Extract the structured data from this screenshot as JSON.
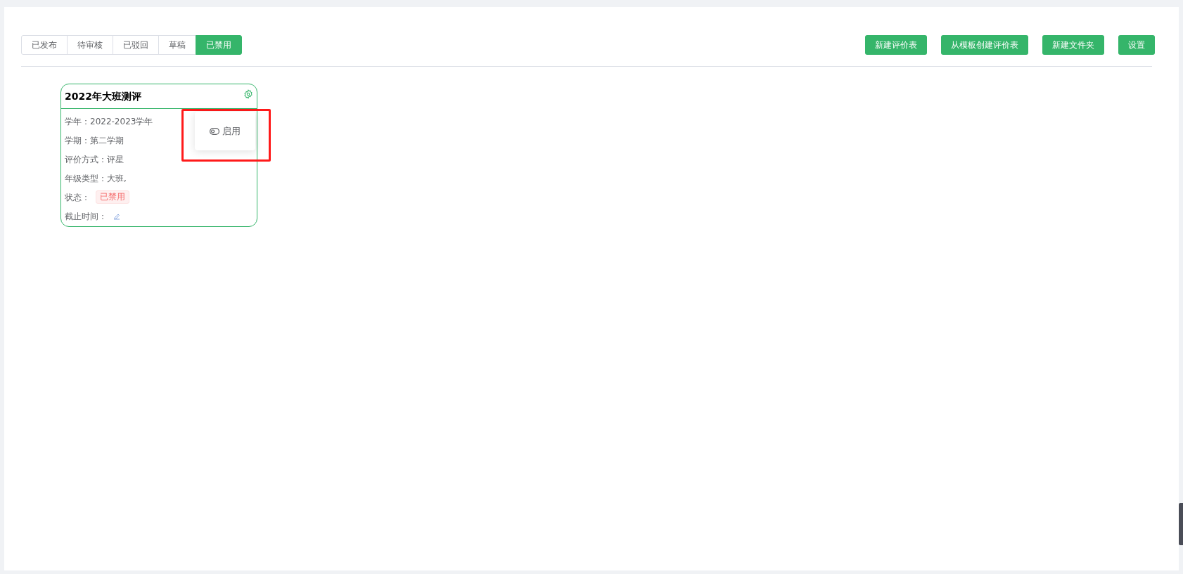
{
  "tabs": [
    {
      "label": "已发布",
      "selected": false
    },
    {
      "label": "待审核",
      "selected": false
    },
    {
      "label": "已驳回",
      "selected": false
    },
    {
      "label": "草稿",
      "selected": false
    },
    {
      "label": "已禁用",
      "selected": true
    }
  ],
  "actions": [
    "新建评价表",
    "从模板创建评价表",
    "新建文件夹",
    "设置"
  ],
  "card": {
    "title": "2022年大班测评",
    "fields": [
      {
        "label": "学年：",
        "value": "2022-2023学年"
      },
      {
        "label": "学期：",
        "value": "第二学期"
      },
      {
        "label": "评价方式：",
        "value": "评星"
      },
      {
        "label": "年级类型：",
        "value": "大班,"
      }
    ],
    "status": {
      "label": "状态：",
      "badge": "已禁用"
    },
    "deadline": {
      "label": "截止时间："
    }
  },
  "popover": {
    "item": "启用"
  }
}
